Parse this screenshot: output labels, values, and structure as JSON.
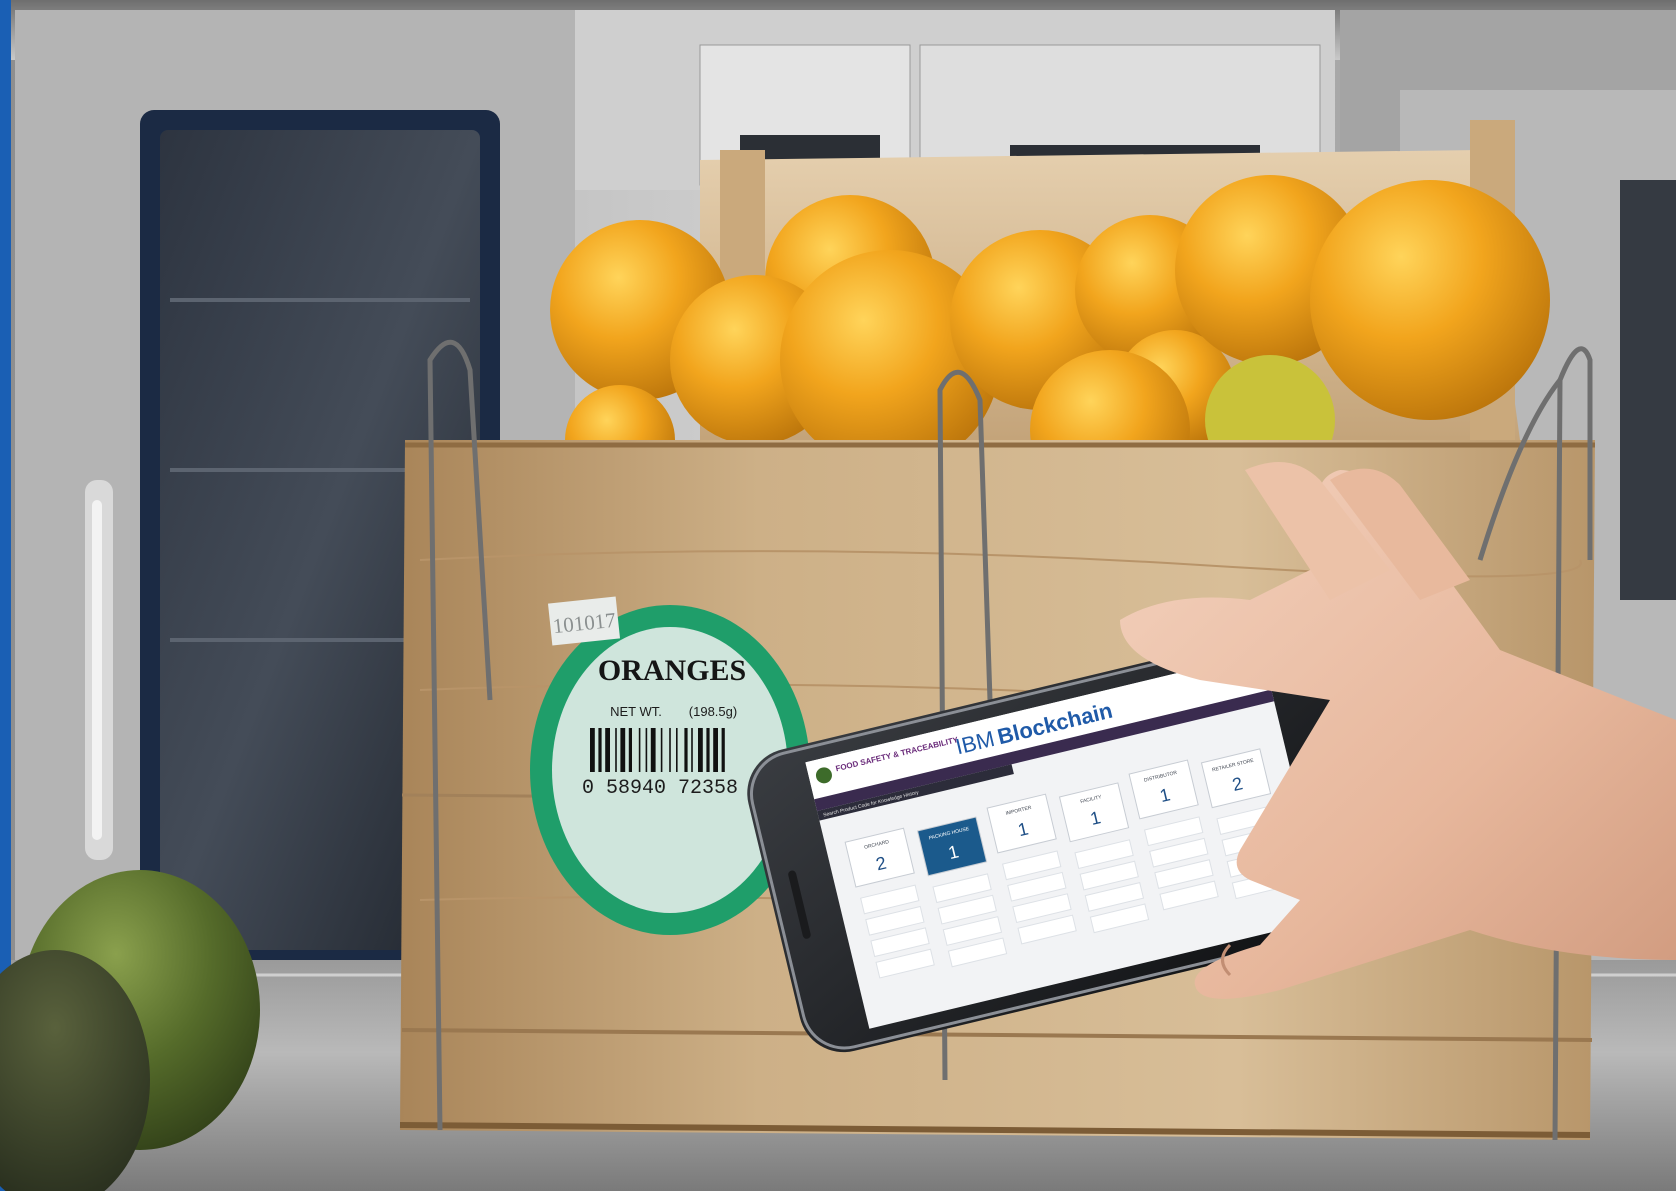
{
  "colors": {
    "accent_strip": "#1a5fb4",
    "label_ring": "#1f9e6a",
    "label_fill": "#cfe5dc",
    "phone_header_blue": "#1f5aa8",
    "active_card": "#1b5a8c",
    "orange": "#f0a21c",
    "crate_wood": "#c9a877"
  },
  "crate_label": {
    "code": "101017",
    "product": "ORANGES",
    "net_wt_label": "NET WT.",
    "net_wt_value": "(198.5g)",
    "barcode_digits": "0 58940 72358"
  },
  "phone": {
    "logo_text": "FOOD SAFETY & TRACEABILITY",
    "brand_prefix": "IBM",
    "brand_name": "Blockchain",
    "search_placeholder": "Search Product Code for Knowledge History",
    "stages": [
      {
        "label": "ORCHARD",
        "count": "2",
        "active": false
      },
      {
        "label": "PACKING HOUSE",
        "count": "1",
        "active": true
      },
      {
        "label": "IMPORTER",
        "count": "1",
        "active": false
      },
      {
        "label": "FACILITY",
        "count": "1",
        "active": false
      },
      {
        "label": "DISTRIBUTOR",
        "count": "1",
        "active": false
      },
      {
        "label": "RETAILER STORE",
        "count": "2",
        "active": false
      }
    ]
  }
}
